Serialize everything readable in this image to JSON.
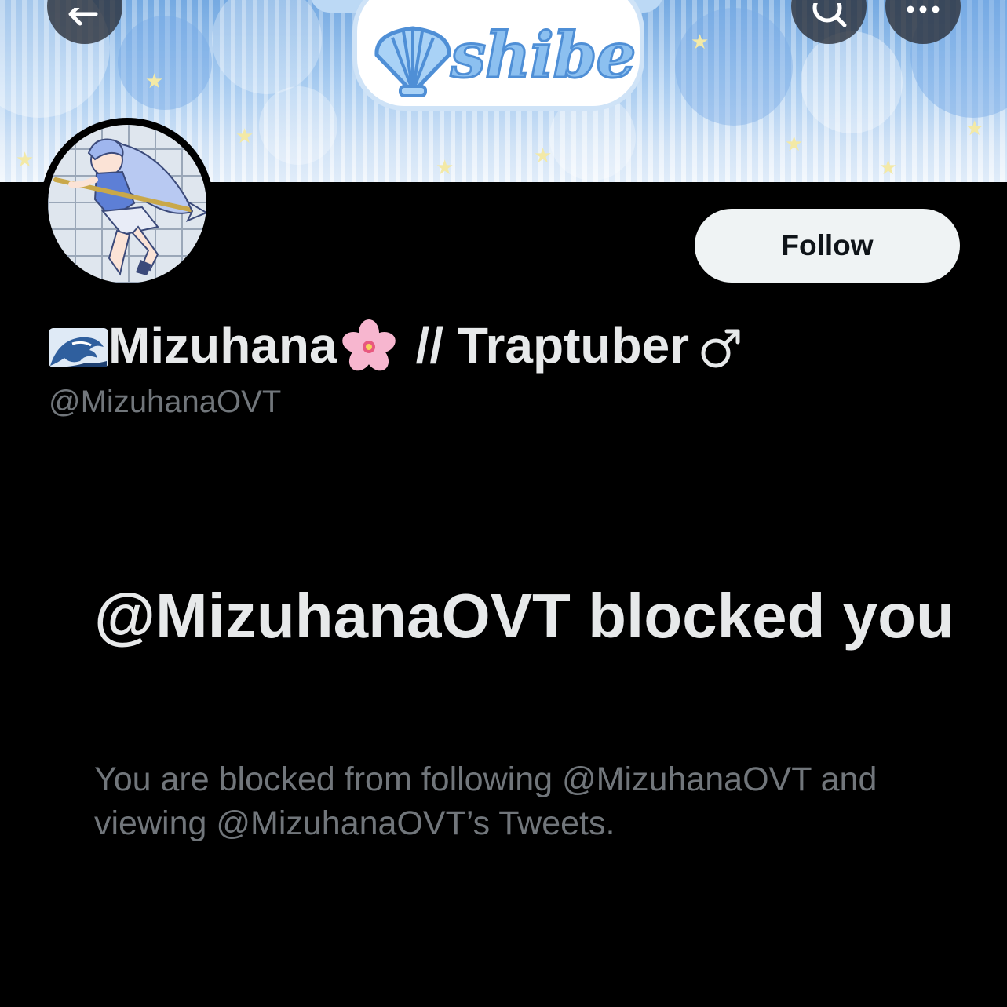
{
  "header": {
    "banner_text": "shibe",
    "back_icon": "arrow-left-icon",
    "search_icon": "search-icon",
    "more_icon": "more-horizontal-icon"
  },
  "profile": {
    "display_name": "Mizuhana",
    "name_suffix": "// Traptuber",
    "handle": "@MizuhanaOVT",
    "follow_label": "Follow"
  },
  "blocked": {
    "title": "@MizuhanaOVT blocked you",
    "description": "You are blocked from following @MizuhanaOVT and viewing @MizuhanaOVT’s Tweets."
  },
  "colors": {
    "background": "#000000",
    "primary_text": "#e7e9ea",
    "secondary_text": "#71767b",
    "follow_bg": "#eff3f4"
  }
}
